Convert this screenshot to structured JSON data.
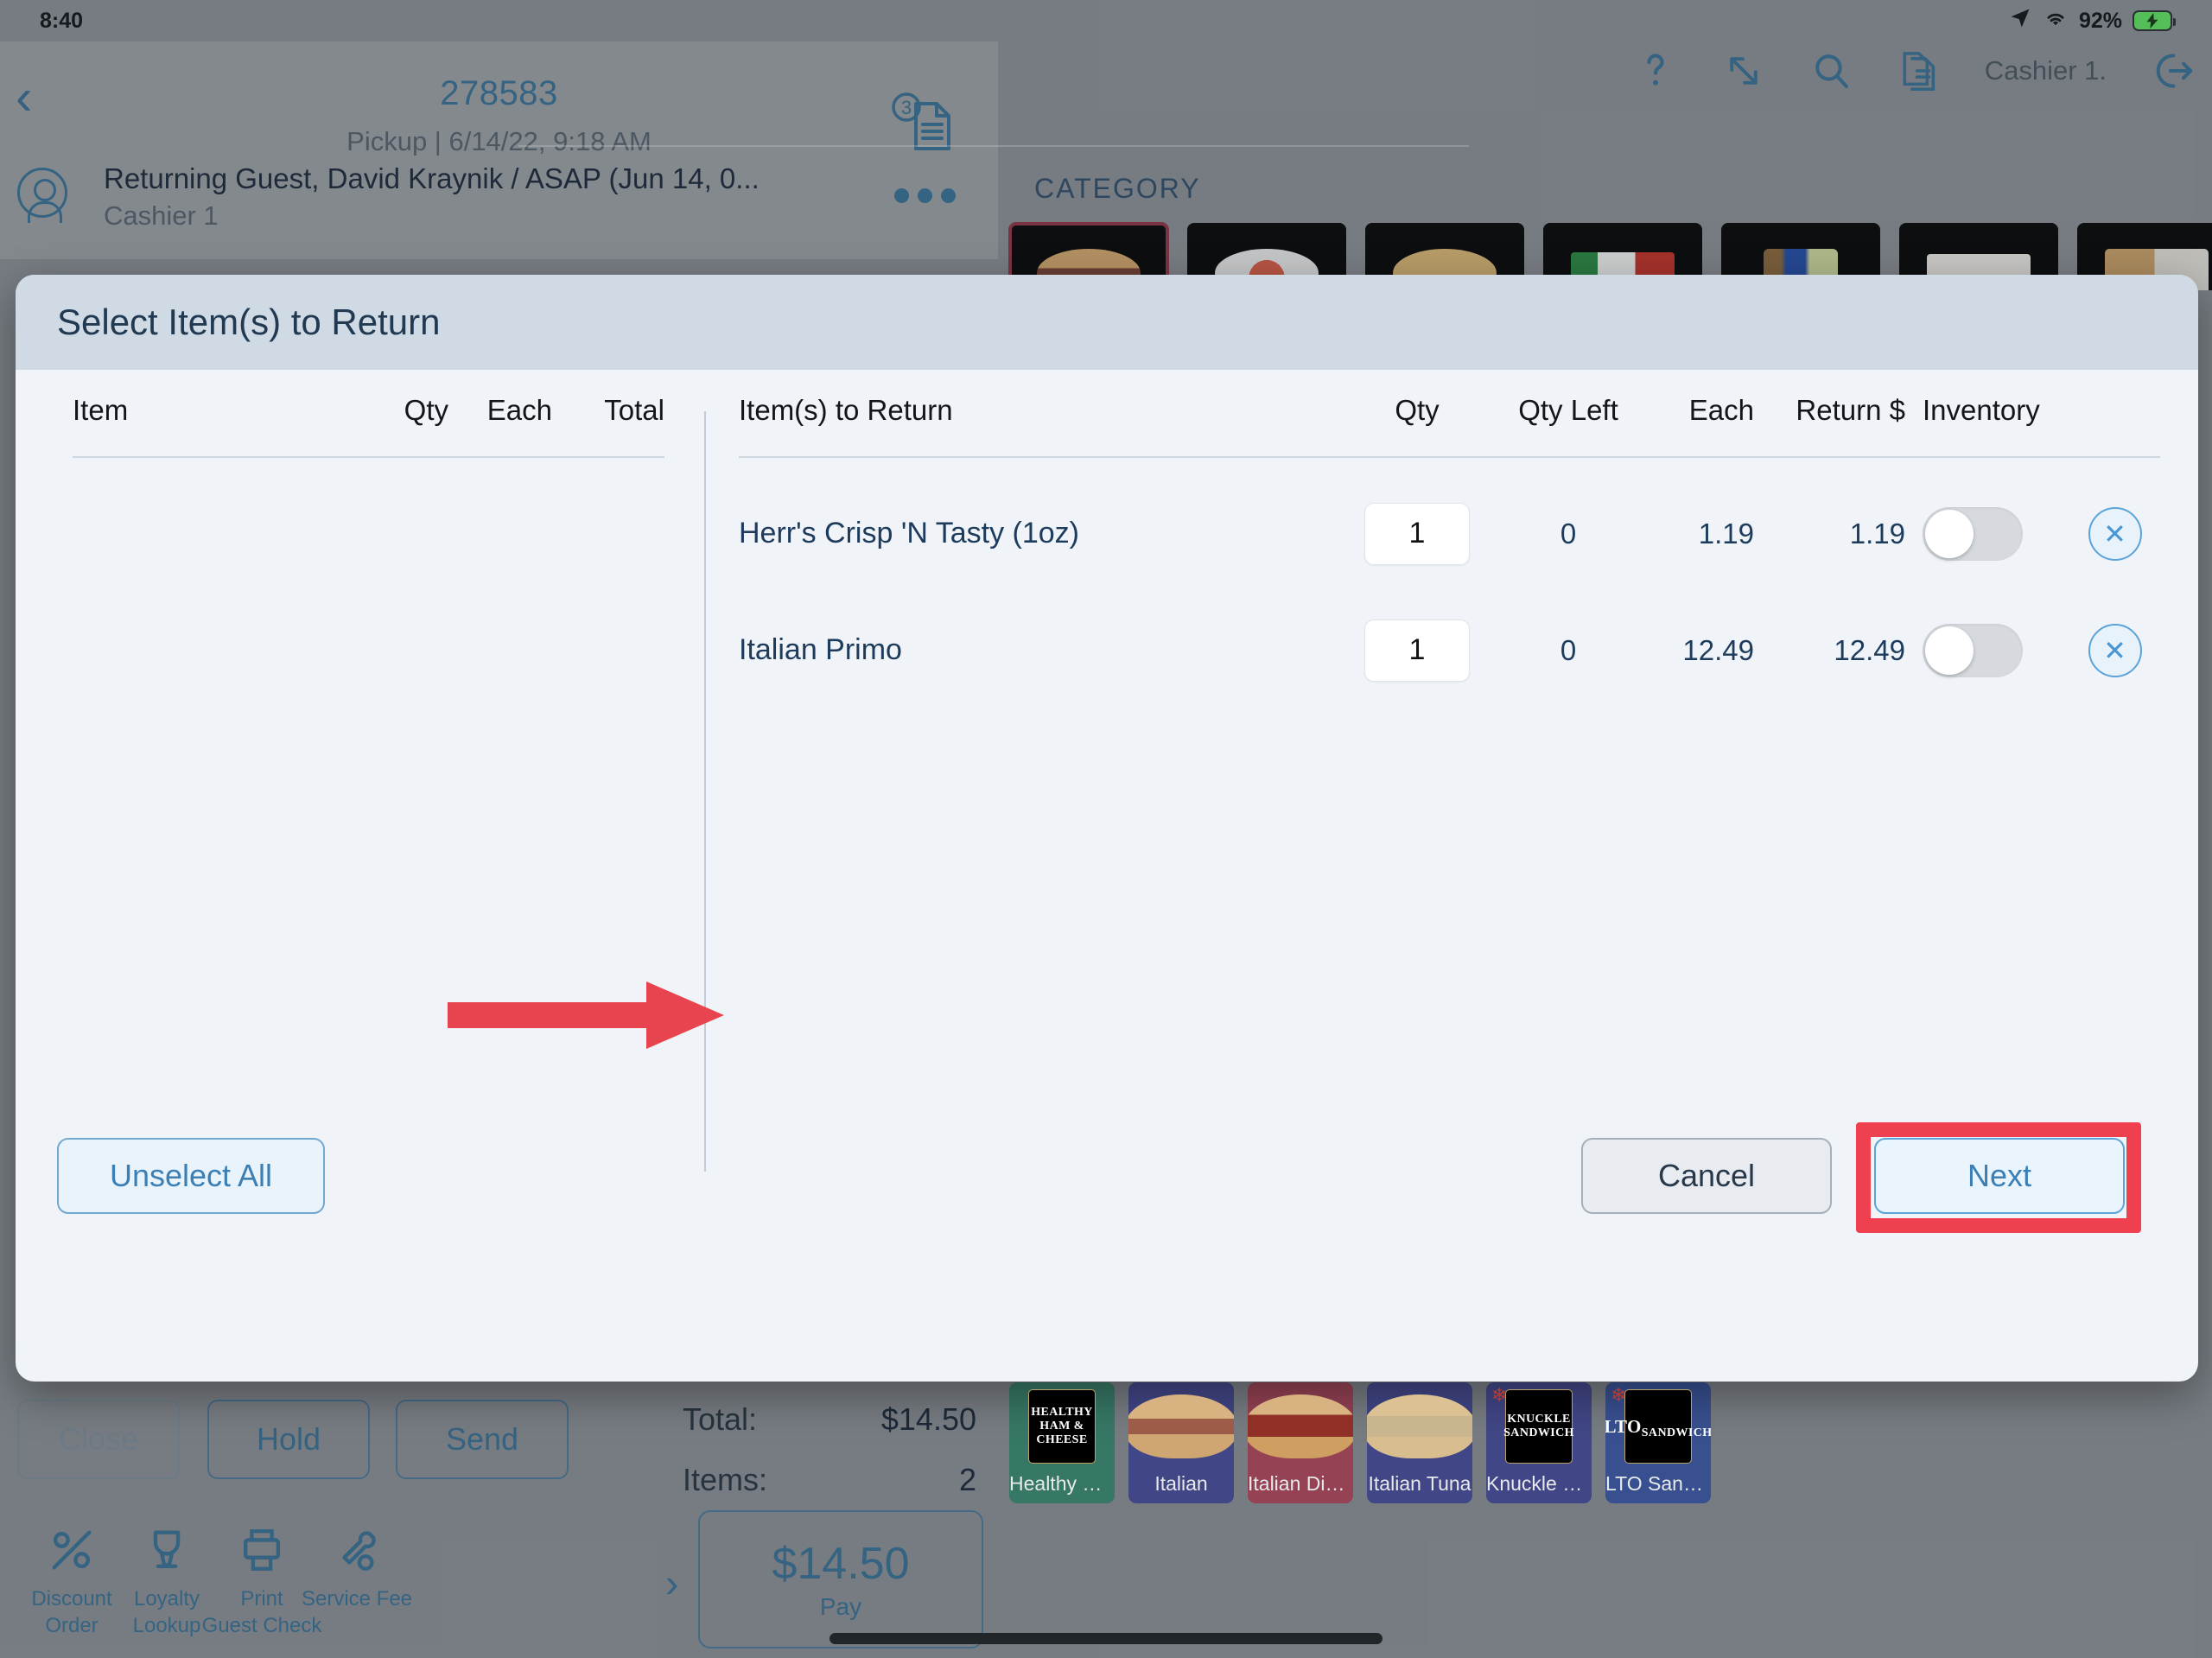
{
  "status_bar": {
    "time": "8:40",
    "location_icon": "location-arrow-icon",
    "wifi_icon": "wifi-icon",
    "battery_percent": "92%",
    "battery_icon": "battery-charging-icon"
  },
  "order_header": {
    "back_icon": "back-chevron-icon",
    "order_number": "278583",
    "order_subtitle": "Pickup | 6/14/22, 9:18 AM",
    "document_badge_count": "3",
    "document_icon": "document-icon",
    "guest_name": "Returning Guest, David Kraynik / ASAP (Jun 14, 0...",
    "guest_cashier": "Cashier 1",
    "avatar_icon": "user-avatar-icon",
    "more_icon": "more-options-icon"
  },
  "top_toolbar": {
    "help_icon": "question-mark-icon",
    "resize_icon": "expand-diagonal-icon",
    "search_icon": "search-icon",
    "receipt_icon": "receipt-pages-icon",
    "cashier_label": "Cashier 1.",
    "logout_icon": "logout-arrow-icon"
  },
  "category_section": {
    "label": "CATEGORY",
    "tiles": [
      {
        "name": "category-tile-sandwiches",
        "selected": true,
        "food": "sandwich"
      },
      {
        "name": "category-tile-salads",
        "selected": false,
        "food": "bowl"
      },
      {
        "name": "category-tile-sides",
        "selected": false,
        "food": "chips"
      },
      {
        "name": "category-tile-packaged",
        "selected": false,
        "food": "package"
      },
      {
        "name": "category-tile-beverages",
        "selected": false,
        "food": "bottles"
      },
      {
        "name": "category-tile-catering",
        "selected": false,
        "food": "box"
      },
      {
        "name": "category-tile-combos",
        "selected": false,
        "food": "combo"
      }
    ]
  },
  "modal": {
    "title": "Select Item(s) to Return",
    "left_table": {
      "headers": {
        "item": "Item",
        "qty": "Qty",
        "each": "Each",
        "total": "Total"
      },
      "rows": []
    },
    "right_table": {
      "headers": {
        "name": "Item(s) to Return",
        "qty": "Qty",
        "qty_left": "Qty Left",
        "each": "Each",
        "return_dollar": "Return $",
        "inventory": "Inventory"
      },
      "rows": [
        {
          "name": "Herr's Crisp 'N Tasty (1oz)",
          "qty": "1",
          "qty_left": "0",
          "each": "1.19",
          "return_dollar": "1.19",
          "inventory_on": false
        },
        {
          "name": "Italian Primo",
          "qty": "1",
          "qty_left": "0",
          "each": "12.49",
          "return_dollar": "12.49",
          "inventory_on": false
        }
      ]
    },
    "footer": {
      "unselect_all": "Unselect All",
      "cancel": "Cancel",
      "next": "Next"
    }
  },
  "order_actions": {
    "close": "Close",
    "hold": "Hold",
    "send": "Send",
    "total_label": "Total:",
    "total_value": "$14.50",
    "items_label": "Items:",
    "items_value": "2",
    "tools": [
      {
        "icon": "percent-icon",
        "line1": "Discount",
        "line2": "Order"
      },
      {
        "icon": "trophy-icon",
        "line1": "Loyalty",
        "line2": "Lookup"
      },
      {
        "icon": "printer-icon",
        "line1": "Print",
        "line2": "Guest Check"
      },
      {
        "icon": "service-fee-icon",
        "line1": "Service Fee",
        "line2": ""
      }
    ],
    "pay_amount": "$14.50",
    "pay_label": "Pay",
    "pay_chevron_icon": "chevron-right-icon"
  },
  "product_tiles": [
    {
      "label": "Healthy Ha...",
      "logo": "HEALTHY\nHAM &\nCHEESE",
      "bg": "#3d8a73",
      "kind": "logo",
      "starred": false
    },
    {
      "label": "Italian",
      "logo": "",
      "bg": "#4a4f9c",
      "kind": "photo",
      "starred": false
    },
    {
      "label": "Italian Diablo",
      "logo": "",
      "bg": "#b04a5e",
      "kind": "photo",
      "starred": false
    },
    {
      "label": "Italian Tuna",
      "logo": "",
      "bg": "#4a4f9c",
      "kind": "photo",
      "starred": false
    },
    {
      "label": "Knuckle Sa...",
      "logo": "KNUCKLE\nSANDWICH",
      "bg": "#4a4f9c",
      "kind": "logo",
      "starred": true
    },
    {
      "label": "LTO Sandwi...",
      "logo": "LTO\nSANDWICH",
      "bg": "#3f5ba8",
      "kind": "logo",
      "starred": true
    }
  ],
  "annotations": {
    "arrow_color": "#e8444f",
    "highlight_color": "#ef4050",
    "arrow_points_to": "Italian Primo row",
    "highlight_target": "Next"
  }
}
